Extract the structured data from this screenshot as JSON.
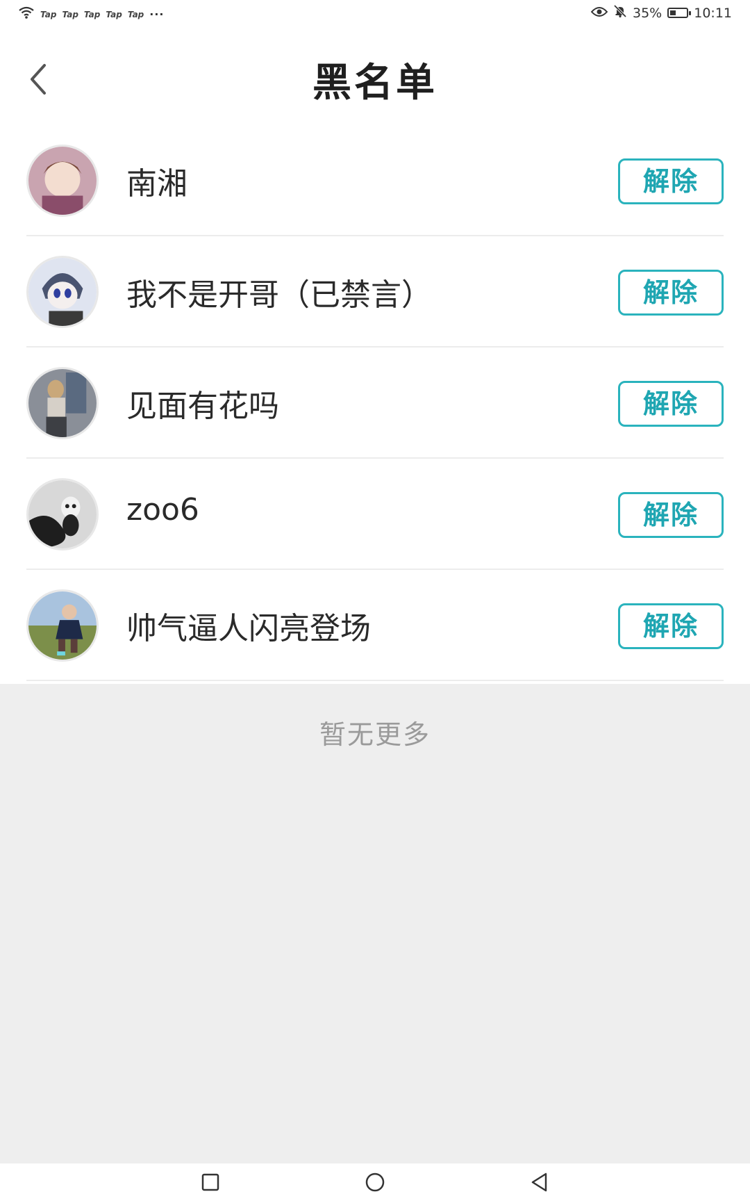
{
  "status_bar": {
    "tap_labels": [
      "Tap",
      "Tap",
      "Tap",
      "Tap",
      "Tap"
    ],
    "more": "···",
    "battery": "35%",
    "battery_level": 0.35,
    "time": "10:11"
  },
  "header": {
    "title": "黑名单"
  },
  "blocked_users": [
    {
      "name": "南湘",
      "action": "解除",
      "avatar_colors": [
        "#c9a4b0",
        "#7a4a3a"
      ]
    },
    {
      "name": "我不是开哥（已禁言）",
      "action": "解除",
      "avatar_colors": [
        "#dfe4f0",
        "#4a5470"
      ]
    },
    {
      "name": "见面有花吗",
      "action": "解除",
      "avatar_colors": [
        "#8a8f98",
        "#3d3f44"
      ]
    },
    {
      "name": "zoo6",
      "action": "解除",
      "avatar_colors": [
        "#d8d8d8",
        "#1e1e1e"
      ]
    },
    {
      "name": "帅气逼人闪亮登场",
      "action": "解除",
      "avatar_colors": [
        "#7c8f4a",
        "#1e2a48"
      ]
    }
  ],
  "footer": {
    "no_more_text": "暂无更多"
  },
  "colors": {
    "accent": "#2ab3bd",
    "footer_bg": "#eeeeee"
  }
}
